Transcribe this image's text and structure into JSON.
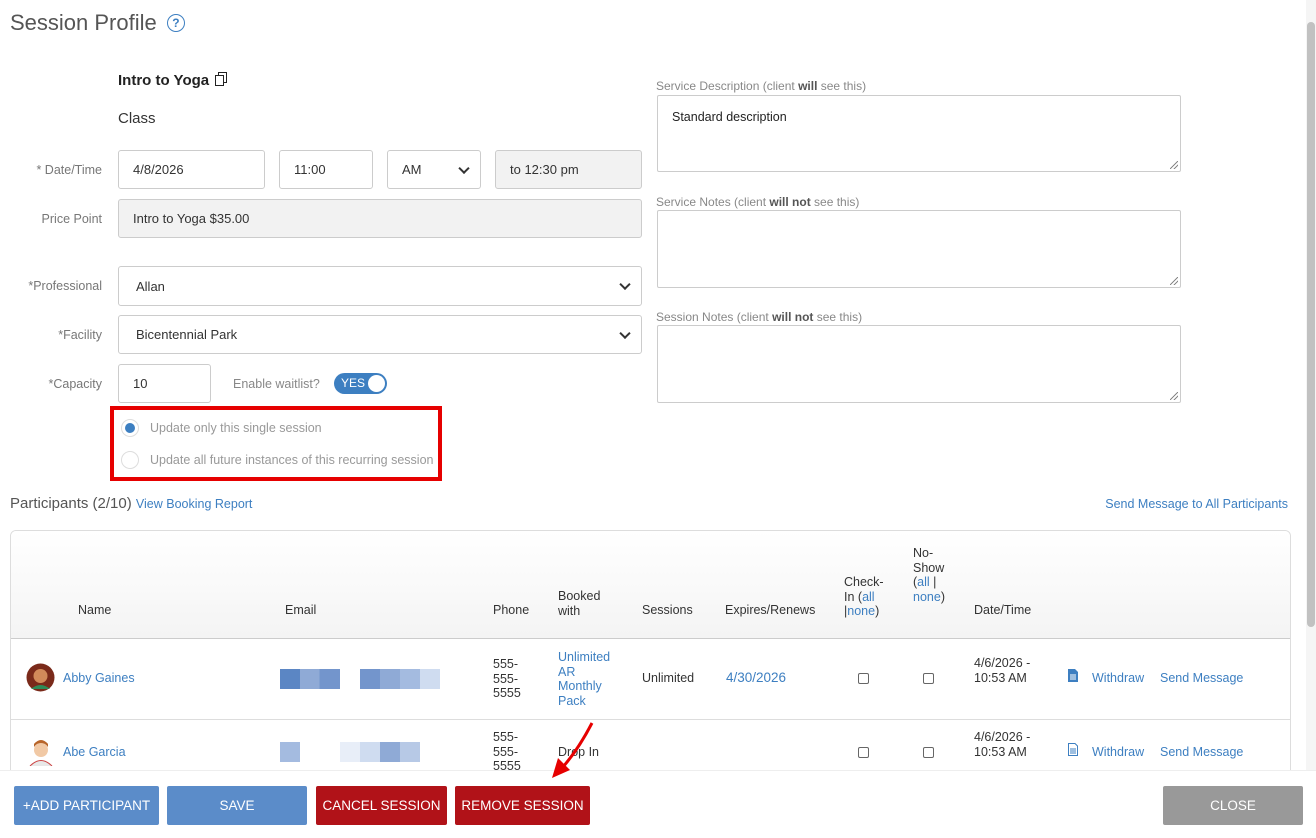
{
  "page": {
    "title": "Session Profile",
    "help_icon": "?"
  },
  "service": {
    "name": "Intro to Yoga",
    "type": "Class"
  },
  "labels": {
    "datetime": "* Date/Time",
    "price_point": "Price Point",
    "professional": "*Professional",
    "facility": "*Facility",
    "capacity": "*Capacity",
    "waitlist": "Enable waitlist?"
  },
  "fields": {
    "date": "4/8/2026",
    "time": "11:00",
    "ampm": "AM",
    "end_time": "to 12:30 pm",
    "price_point": "Intro to Yoga $35.00",
    "professional": "Allan",
    "facility": "Bicentennial Park",
    "capacity": "10",
    "waitlist_toggle": "YES"
  },
  "recurrence": {
    "option_single": "Update only this single session",
    "option_all": "Update all future instances of this recurring session",
    "selected": "single"
  },
  "notes": {
    "desc_label_pre": "Service Description (client ",
    "desc_label_bold": "will",
    "desc_label_post": " see this)",
    "desc_value": "Standard description",
    "svc_label_pre": "Service Notes (client ",
    "svc_label_bold": "will not",
    "svc_label_post": " see this)",
    "sess_label_pre": "Session Notes (client ",
    "sess_label_bold": "will not",
    "sess_label_post": " see this)"
  },
  "participants": {
    "heading": "Participants (2/10)",
    "booking_report": "View Booking Report",
    "send_all": "Send Message to All Participants",
    "columns": {
      "name": "Name",
      "email": "Email",
      "phone": "Phone",
      "booked_with": "Booked with",
      "sessions": "Sessions",
      "expires": "Expires/Renews",
      "checkin": "Check-In",
      "noshow": "No-Show",
      "all": "all",
      "none": "none",
      "datetime": "Date/Time"
    },
    "rows": [
      {
        "name": "Abby Gaines",
        "phone": "555-555-5555",
        "booked": "Unlimited AR Monthly Pack",
        "sessions": "Unlimited",
        "expires": "4/30/2026",
        "datetime": "4/6/2026 - 10:53 AM",
        "withdraw": "Withdraw",
        "send": "Send Message"
      },
      {
        "name": "Abe Garcia",
        "phone": "555-555-5555",
        "booked": "Drop In",
        "sessions": "",
        "expires": "",
        "datetime": "4/6/2026 - 10:53 AM",
        "withdraw": "Withdraw",
        "send": "Send Message"
      }
    ]
  },
  "buttons": {
    "add": "+ADD PARTICIPANT",
    "save": "SAVE",
    "cancel": "CANCEL SESSION",
    "remove": "REMOVE SESSION",
    "close": "CLOSE"
  },
  "colors": {
    "accent": "#3d7fc1",
    "danger": "#b11218",
    "highlight": "#e60000"
  },
  "icons": [
    "help-icon",
    "copy-icon",
    "chevron-down-icon",
    "document-icon",
    "arrow-annotation-icon"
  ]
}
